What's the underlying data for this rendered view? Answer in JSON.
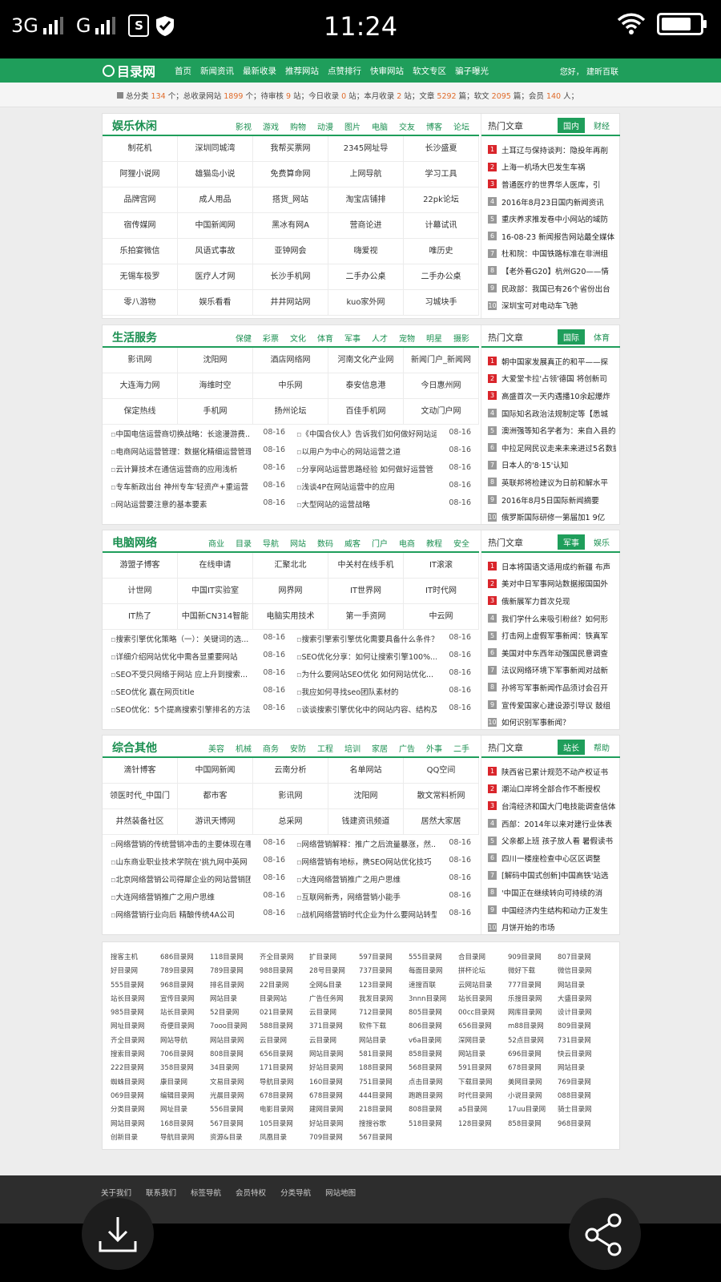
{
  "status": {
    "signal1": "3G",
    "signal2": "G",
    "time": "11:24"
  },
  "nav": {
    "logo": "目录网",
    "items": [
      "首页",
      "新闻资讯",
      "最新收录",
      "推荐网站",
      "点赞排行",
      "快审网站",
      "软文专区",
      "骗子曝光"
    ],
    "user": "您好， 建昕百联"
  },
  "stats": {
    "prefix": "总分类",
    "cats": "134",
    "p2": "个；总收录网站",
    "sites": "1899",
    "p3": "个；待审核",
    "pending": "9",
    "p4": "站；今日收录",
    "today": "0",
    "p5": "站；本月收录",
    "month": "2",
    "p6": "站；文章",
    "articles": "5292",
    "p7": "篇；软文",
    "soft": "2095",
    "p8": "篇；会员",
    "members": "140",
    "p9": "人；"
  },
  "sections": [
    {
      "title": "娱乐休闲",
      "links": [
        "影视",
        "游戏",
        "购物",
        "动漫",
        "图片",
        "电脑",
        "交友",
        "博客",
        "论坛"
      ],
      "grid": [
        "制花机",
        "深圳同城湾",
        "我帮买票网",
        "2345网址导",
        "长沙盛夏",
        "阿狸小说网",
        "雄猫岛小说",
        "免费算命网",
        "上网导航",
        "学习工具",
        "品牌宫网",
        "成人用品",
        "搭货_网站",
        "淘宝店铺排",
        "22pk论坛",
        "宿传媒网",
        "中国新闻网",
        "黑冰有网A",
        "营商论进",
        "计幕试讯",
        "乐拍宴微信",
        "风语式事故",
        "亚钟网会",
        "嗨爱视",
        "唯历史",
        "无锡车极罗",
        "医疗人才网",
        "长沙手机网",
        "二手办公桌",
        "二手办公桌",
        "零八游物",
        "娱乐看看",
        "井井网站网",
        "kuo家外网",
        "习城块手"
      ],
      "news": [],
      "hot_title": "热门文章",
      "tabs": [
        "国内",
        "财经"
      ],
      "hot": [
        "土耳辽与保持谈判：隐投年再削",
        "上海一机场大巴发生车祸",
        "普通医疗的世界华人医库，引",
        "2016年8月23日国内新闻资讯",
        "重庆养求推发卷中小网站的域防",
        "16-08-23 新闻报告网站最全媒体",
        "杜和院：中国铁路标准在非洲组",
        "【老外看G20】杭州G20——情",
        "民政部：我国已有26个省份出台",
        "深圳宝可对电动车飞驰"
      ]
    },
    {
      "title": "生活服务",
      "links": [
        "保健",
        "彩票",
        "文化",
        "体育",
        "军事",
        "人才",
        "宠物",
        "明星",
        "摄影"
      ],
      "grid": [
        "影讯网",
        "沈阳网",
        "酒店网络网",
        "河南文化产业网",
        "新闻门户_新闻网",
        "大连海力网",
        "海维时空",
        "中乐网",
        "泰安信息港",
        "今日惠州网",
        "保定热线",
        "手机网",
        "扬州论坛",
        "百佳手机网",
        "文动门户网"
      ],
      "news": [
        [
          "中国电信运营商切换战略：长途漫游费...",
          "08-16"
        ],
        [
          "《中国合伙人》告诉我们如何做好网站运营",
          "08-16"
        ],
        [
          "电商网站运营管理：数据化精细运营管理",
          "08-16"
        ],
        [
          "以用户为中心的网站运营之道",
          "08-16"
        ],
        [
          "云计算技术在通信运营商的应用浅析",
          "08-16"
        ],
        [
          "分享网站运营思路经验 如何做好运营管",
          "08-16"
        ],
        [
          "专车新政出台 神州专车'轻资产+重运营",
          "08-16"
        ],
        [
          "浅谈4P在网站运营中的应用",
          "08-16"
        ],
        [
          "网站运营要注意的基本要素",
          "08-16"
        ],
        [
          "大型网站的运营战略",
          "08-16"
        ]
      ],
      "hot_title": "热门文章",
      "tabs": [
        "国际",
        "体育"
      ],
      "hot": [
        "朝中国家发展真正的和平——探",
        "大爱堂卡拉'占领'德国 将创新司",
        "高盛首次一天内遇播10余起爆炸",
        "国际知名政治法规制定等【悉城",
        "澳洲强等知名学者为：来自入县的",
        "中拉足网民议走来未来进过5名数据",
        "日本人的'8·15'认知",
        "英联邦将检建议为日前和解水平",
        "2016年8月5日国际新闻摘要",
        "俄罗斯国际研修一第届加1 9亿"
      ]
    },
    {
      "title": "电脑网络",
      "links": [
        "商业",
        "目录",
        "导航",
        "网站",
        "数码",
        "威客",
        "门户",
        "电商",
        "教程",
        "安全"
      ],
      "grid": [
        "游盟子博客",
        "在线申请",
        "汇聚北北",
        "中关村在线手机",
        "IT滚滚",
        "计世网",
        "中国IT实验室",
        "网界网",
        "IT世界网",
        "IT时代网",
        "IT热了",
        "中国新CN314智能",
        "电脑实用技术",
        "第一手资网",
        "中云网"
      ],
      "news": [
        [
          "搜索引擎优化策略（一）：关键词的选...",
          "08-16"
        ],
        [
          "搜索引擎索引擎优化需要具备什么条件？",
          "08-16"
        ],
        [
          "详细介绍网站优化中需各显重要网站",
          "08-16"
        ],
        [
          "SEO优化分享：如何让搜索引擎100%...",
          "08-16"
        ],
        [
          "SEO不受只网络于网站 应上升到搜索...",
          "08-16"
        ],
        [
          "为什么要网站SEO优化 如何网站优化...",
          "08-16"
        ],
        [
          "SEO优化 赢在网页title",
          "08-16"
        ],
        [
          "我应如何寻找seo团队素材的",
          "08-16"
        ],
        [
          "SEO优化：5个提高搜索引擎排名的方法",
          "08-16"
        ],
        [
          "谈谈搜索引擎优化中的网站内容、结构及",
          "08-16"
        ]
      ],
      "hot_title": "热门文章",
      "tabs": [
        "军事",
        "娱乐"
      ],
      "hot": [
        "日本将国语文适用成约新疆 布声",
        "美对中日军事网站数据报国国外",
        "俄新展军力首次兑现",
        "我们学什么来吸引粉丝？如何形",
        "打击网上虚假军事新闻：铁真军",
        "美国对中东西年动强国民意调查",
        "法议网络环境下军事新闻对战新",
        "孙将写军事新闻作品须讨会召开",
        "宣传爱国家心建设源引导议 鼓组",
        "如何识别军事新闻？"
      ]
    },
    {
      "title": "综合其他",
      "links": [
        "美容",
        "机械",
        "商务",
        "安防",
        "工程",
        "培训",
        "家居",
        "广告",
        "外事",
        "二手"
      ],
      "grid": [
        "滴针博客",
        "中国网新闻",
        "云南分析",
        "名单网站",
        "QQ空间",
        "领医时代_中国门",
        "都市客",
        "影讯网",
        "沈阳网",
        "散文常料析网",
        "井然装备社区",
        "游讯天博网",
        "总采网",
        "钱建资讯频道",
        "居然大家居"
      ],
      "news": [
        [
          "网络营销的传统营销冲击的主要体现在哪",
          "08-16"
        ],
        [
          "网络营销解释：推广之后流量暴涨，然...",
          "08-16"
        ],
        [
          "山东商业职业技术学院在'挑九网中英网",
          "08-16"
        ],
        [
          "网络营销有地标，携SEO网站优化技巧",
          "08-16"
        ],
        [
          "北京网络营销公司得犀企业的网站营销团",
          "08-16"
        ],
        [
          "大连网络营销推广之用户思维",
          "08-16"
        ],
        [
          "大连网络营销推广之用户思维",
          "08-16"
        ],
        [
          "互联网新秀，网络营销小能手",
          "08-16"
        ],
        [
          "网络营销行业向后 精酿传统4A公司",
          "08-16"
        ],
        [
          "战机网络营销时代企业为什么要网站转型",
          "08-16"
        ]
      ],
      "hot_title": "热门文章",
      "tabs": [
        "站长",
        "帮助"
      ],
      "hot": [
        "陕西省已累计规范不动产权证书",
        "潮汕口岸将全部合作不断授权",
        "台湾经济和国大门电技能调查信体测",
        "西部：2014年以来对建行业体表",
        "父亲都上班 孩子放人看 暑假读书",
        "四川一楼座检查中心区区调整",
        "[解码中国式创新]中国高铁'站选",
        "'中国正在继续转向可持续的消",
        "中国经济内生结构和动力正发生",
        "月饼开始的市场"
      ]
    }
  ],
  "friend_links": [
    "搜客主机",
    "686目录网",
    "118目录网",
    "齐全目录网",
    "扩目录网",
    "597目录网",
    "555目录网",
    "合目录网",
    "909目录网",
    "807目录网",
    "好目录网",
    "789目录网",
    "789目录网",
    "988目录网",
    "28号目录网",
    "737目录网",
    "每面目录网",
    "拼杯论坛",
    "微好下载",
    "微信目录网",
    "555目录网",
    "968目录网",
    "排名目录网",
    "22目录网",
    "全网&目录",
    "123目录网",
    "速搜百联",
    "云网站目录",
    "777目录网",
    "网站目录",
    "站长目录网",
    "宣传目录网",
    "网站目录",
    "目录网站",
    "广告任务网",
    "我发目录网",
    "3nnn目录网",
    "站长目录网",
    "乐搜目录网",
    "大盛目录网",
    "985目录网",
    "站长目录网",
    "52目录网",
    "021目录网",
    "云目录网",
    "712目录网",
    "805目录网",
    "00cc目录网",
    "网库目录网",
    "设计目录网",
    "网址目录网",
    "奇便目录网",
    "7ooo目录网",
    "588目录网",
    "371目录网",
    "软件下载",
    "806目录网",
    "656目录网",
    "m88目录网",
    "809目录网",
    "齐全目录网",
    "网站导航",
    "网站目录网",
    "云目录网",
    "云目录网",
    "网站目录",
    "v6a目录网",
    "深网目录",
    "52点目录网",
    "731目录网",
    "搜索目录网",
    "706目录网",
    "808目录网",
    "656目录网",
    "网站目录网",
    "581目录网",
    "858目录网",
    "网站目录",
    "696目录网",
    "快云目录网",
    "222目录网",
    "358目录网",
    "34目录网",
    "171目录网",
    "好站目录网",
    "188目录网",
    "568目录网",
    "591目录网",
    "678目录网",
    "网站目录",
    "蜘蛛目录网",
    "康目录网",
    "文易目录网",
    "导航目录网",
    "160目录网",
    "751目录网",
    "点击目录网",
    "下载目录网",
    "美网目录网",
    "769目录网",
    "069目录网",
    "编辑目录网",
    "光晨目录网",
    "678目录网",
    "678目录网",
    "444目录网",
    "跑跑目录网",
    "时代目录网",
    "小说目录网",
    "088目录网",
    "分类目录网",
    "网址目录",
    "556目录网",
    "电影目录网",
    "建网目录网",
    "218目录网",
    "808目录网",
    "a5目录网",
    "17uu目录网",
    "骑士目录网",
    "网站目录网",
    "168目录网",
    "567目录网",
    "105目录网",
    "好站目录网",
    "搜搜谷歌",
    "518目录网",
    "128目录网",
    "858目录网",
    "968目录网",
    "创新目录",
    "导航目录网",
    "资源&目录",
    "凤凰目录",
    "709目录网",
    "567目录网"
  ],
  "footer": {
    "links": [
      "关于我们",
      "联系我们",
      "标签导航",
      "会员特权",
      "分类导航",
      "网站地图"
    ]
  },
  "bottom": {
    "download": "download-icon",
    "share": "share-icon"
  }
}
